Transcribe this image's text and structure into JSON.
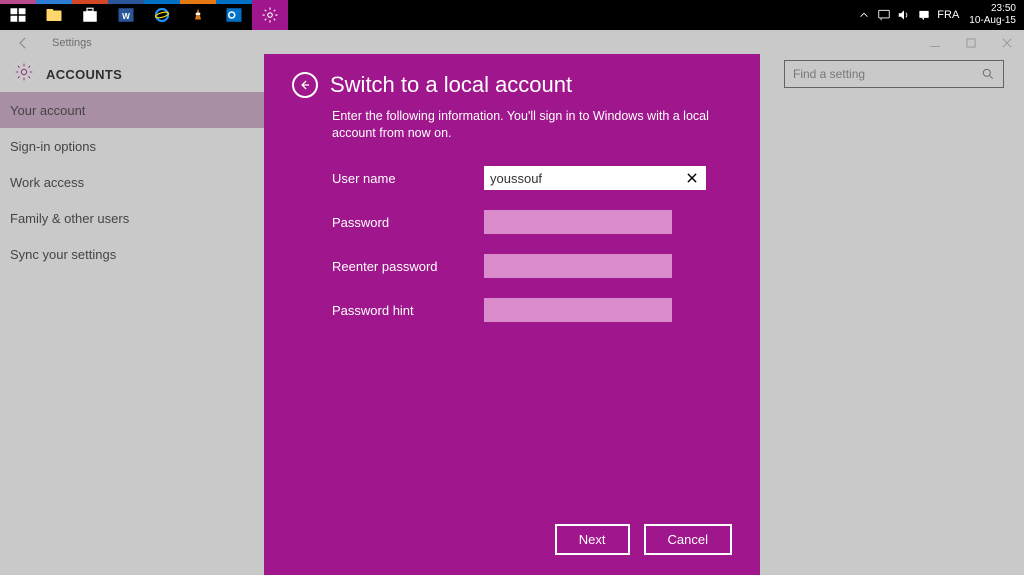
{
  "taskbar": {
    "lang": "FRA",
    "time": "23:50",
    "date": "10-Aug-15"
  },
  "settings_titlebar": "Settings",
  "settings_header": {
    "title": "ACCOUNTS",
    "search_placeholder": "Find a setting"
  },
  "sidebar": {
    "items": [
      "Your account",
      "Sign-in options",
      "Work access",
      "Family & other users",
      "Sync your settings"
    ]
  },
  "modal": {
    "title": "Switch to a local account",
    "subtitle": "Enter the following information. You'll sign in to Windows with a local account from now on.",
    "labels": {
      "username": "User name",
      "password": "Password",
      "reenter": "Reenter password",
      "hint": "Password hint"
    },
    "values": {
      "username": "youssouf"
    },
    "buttons": {
      "next": "Next",
      "cancel": "Cancel"
    }
  }
}
